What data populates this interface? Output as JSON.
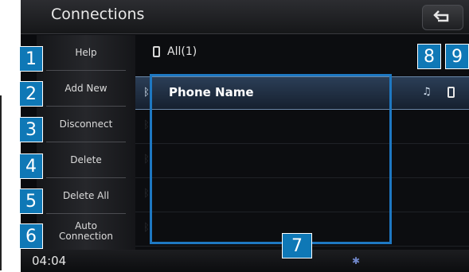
{
  "title": "Connections",
  "filter": {
    "label": "All(1)"
  },
  "sidebar": {
    "items": [
      {
        "label": "Help"
      },
      {
        "label": "Add New"
      },
      {
        "label": "Disconnect"
      },
      {
        "label": "Delete"
      },
      {
        "label": "Delete All"
      },
      {
        "label": "Auto\nConnection"
      }
    ]
  },
  "devices": [
    {
      "label": "Phone Name",
      "selected": true,
      "status_icons": [
        "music-icon",
        "phone-icon"
      ]
    },
    {
      "label": "",
      "selected": false
    },
    {
      "label": "",
      "selected": false
    },
    {
      "label": "",
      "selected": false
    },
    {
      "label": "",
      "selected": false
    }
  ],
  "statusbar": {
    "clock": "04:04"
  },
  "callouts": [
    "1",
    "2",
    "3",
    "4",
    "5",
    "6",
    "7",
    "8",
    "9"
  ],
  "colors": {
    "callout_bg": "#0f78b6",
    "highlight": "#2b3e57",
    "screen_bg": "#0a0b0e"
  }
}
